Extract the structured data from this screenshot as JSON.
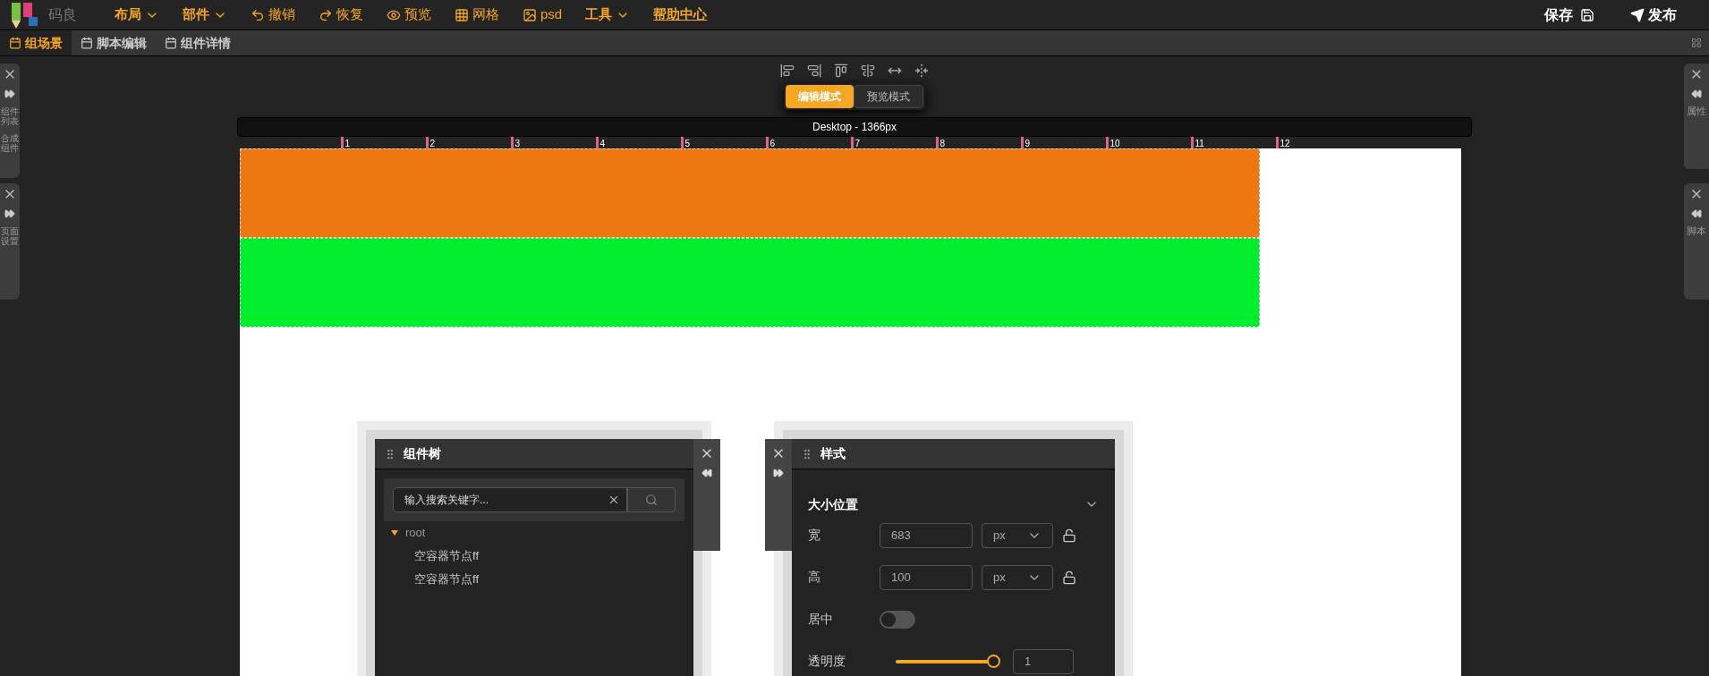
{
  "app": {
    "name": "码良"
  },
  "menu": [
    {
      "label": "布局",
      "kind": "dropdown"
    },
    {
      "label": "部件",
      "kind": "dropdown"
    },
    {
      "label": "撤销",
      "kind": "undo"
    },
    {
      "label": "恢复",
      "kind": "redo"
    },
    {
      "label": "预览",
      "kind": "preview"
    },
    {
      "label": "网格",
      "kind": "grid"
    },
    {
      "label": "psd",
      "kind": "image"
    },
    {
      "label": "工具",
      "kind": "dropdown"
    },
    {
      "label": "帮助中心",
      "kind": "link"
    }
  ],
  "actions": [
    {
      "label": "保存",
      "kind": "save"
    },
    {
      "label": "发布",
      "kind": "publish"
    }
  ],
  "tabs": [
    {
      "label": "组场景",
      "selected": true
    },
    {
      "label": "脚本编辑",
      "selected": false
    },
    {
      "label": "组件详情",
      "selected": false
    }
  ],
  "left_dock": [
    {
      "labels": [
        "组件列表",
        "合成组件"
      ]
    },
    {
      "labels": [
        "页面设置"
      ]
    }
  ],
  "right_dock": [
    {
      "label": "属性"
    },
    {
      "label": "脚本"
    }
  ],
  "mode_toggle": [
    {
      "label": "编辑模式",
      "selected": true
    },
    {
      "label": "预览模式",
      "selected": false
    }
  ],
  "device_bar": {
    "label": "Desktop - 1366px"
  },
  "ruler": {
    "marks": [
      "1",
      "2",
      "3",
      "4",
      "5",
      "6",
      "7",
      "8",
      "9",
      "10",
      "11",
      "12"
    ]
  },
  "canvas": {
    "blocks": [
      {
        "color": "#ee7710"
      },
      {
        "color": "#00ee2e"
      }
    ]
  },
  "component_tree": {
    "title": "组件树",
    "search": {
      "placeholder": "输入搜索关键字..."
    },
    "nodes": [
      {
        "label": "root",
        "expanded": true,
        "children": [
          {
            "label": "空容器节点ff"
          },
          {
            "label": "空容器节点ff"
          }
        ]
      }
    ]
  },
  "style_panel": {
    "title": "样式",
    "section": {
      "title": "大小位置",
      "expanded": true
    },
    "fields": [
      {
        "kind": "number",
        "label": "宽",
        "value": "683",
        "unit": "px",
        "locked": false
      },
      {
        "kind": "number",
        "label": "高",
        "value": "100",
        "unit": "px",
        "locked": false
      },
      {
        "kind": "switch",
        "label": "居中",
        "on": false
      },
      {
        "kind": "slider",
        "label": "透明度",
        "level": 1,
        "value": "1"
      }
    ]
  }
}
